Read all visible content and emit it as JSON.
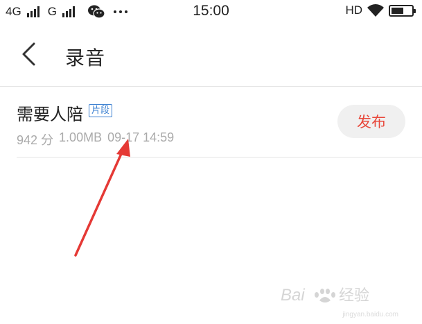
{
  "status_bar": {
    "network_1": "4G",
    "network_2": "G",
    "time": "15:00",
    "hd": "HD",
    "battery_level": 0.6,
    "icons": [
      "signal-icon",
      "wechat-icon",
      "more-icon",
      "wifi-icon",
      "battery-icon"
    ]
  },
  "header": {
    "back_icon": "chevron-left-icon",
    "title": "录音"
  },
  "recordings": [
    {
      "title": "需要人陪",
      "badge": "片段",
      "count": "942 分",
      "size": "1.00MB",
      "timestamp": "09-17 14:59",
      "action_label": "发布"
    }
  ],
  "colors": {
    "accent": "#e8483b",
    "badge": "#3a7fd0",
    "annotation": "#e53935"
  },
  "watermark": {
    "logo": "Baidu经验",
    "url": "jingyan.baidu.com"
  }
}
